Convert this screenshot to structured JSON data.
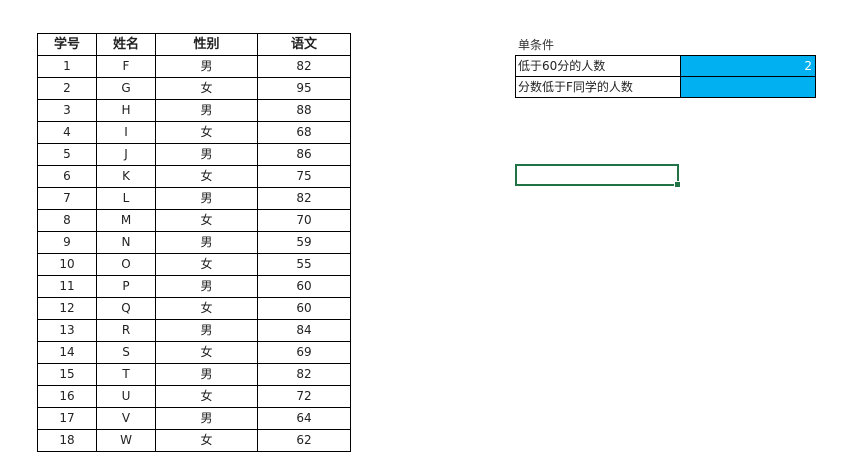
{
  "table": {
    "headers": [
      "学号",
      "姓名",
      "性别",
      "语文"
    ],
    "rows": [
      [
        "1",
        "F",
        "男",
        "82"
      ],
      [
        "2",
        "G",
        "女",
        "95"
      ],
      [
        "3",
        "H",
        "男",
        "88"
      ],
      [
        "4",
        "I",
        "女",
        "68"
      ],
      [
        "5",
        "J",
        "男",
        "86"
      ],
      [
        "6",
        "K",
        "女",
        "75"
      ],
      [
        "7",
        "L",
        "男",
        "82"
      ],
      [
        "8",
        "M",
        "女",
        "70"
      ],
      [
        "9",
        "N",
        "男",
        "59"
      ],
      [
        "10",
        "O",
        "女",
        "55"
      ],
      [
        "11",
        "P",
        "男",
        "60"
      ],
      [
        "12",
        "Q",
        "女",
        "60"
      ],
      [
        "13",
        "R",
        "男",
        "84"
      ],
      [
        "14",
        "S",
        "女",
        "69"
      ],
      [
        "15",
        "T",
        "男",
        "82"
      ],
      [
        "16",
        "U",
        "女",
        "72"
      ],
      [
        "17",
        "V",
        "男",
        "64"
      ],
      [
        "18",
        "W",
        "女",
        "62"
      ]
    ]
  },
  "condition": {
    "title": "单条件",
    "rows": [
      {
        "label": "低于60分的人数",
        "value": "2"
      },
      {
        "label": "分数低于F同学的人数",
        "value": ""
      }
    ],
    "value_fill_color": "#00b0f0"
  },
  "selection": {
    "border_color": "#217346"
  }
}
